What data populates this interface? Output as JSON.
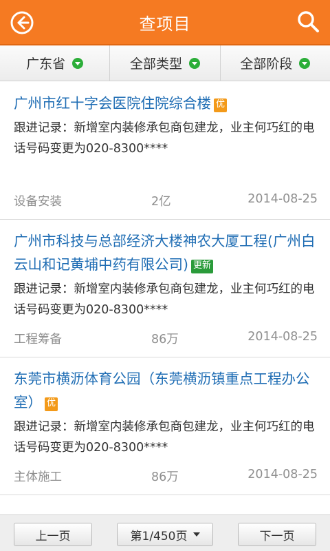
{
  "header": {
    "title": "查项目",
    "back_icon": "back-arrow-circle-icon",
    "search_icon": "magnifier-icon",
    "color": "#f57a22"
  },
  "filters": [
    {
      "label": "广东省"
    },
    {
      "label": "全部类型"
    },
    {
      "label": "全部阶段"
    }
  ],
  "projects": [
    {
      "name": "广州市红十字会医院住院综合楼",
      "badge": "优",
      "record": "跟进记录：新增室内装修承包商包建龙，业主何巧红的电话号码变更为020-8300****",
      "stage": "设备安装",
      "amount": "2亿",
      "date": "2014-08-25"
    },
    {
      "name": "广州市科技与总部经济大楼神农大厦工程(广州白云山和记黄埔中药有限公司)",
      "badge": "更新",
      "record": "跟进记录：新增室内装修承包商包建龙，业主何巧红的电话号码变更为020-8300****",
      "stage": "工程筹备",
      "amount": "86万",
      "date": "2014-08-25"
    },
    {
      "name": "东莞市横沥体育公园（东莞横沥镇重点工程办公室）",
      "badge": "优",
      "record": "跟进记录：新增室内装修承包商包建龙，业主何巧红的电话号码变更为020-8300****",
      "stage": "主体施工",
      "amount": "86万",
      "date": "2014-08-25"
    }
  ],
  "pager": {
    "prev": "上一页",
    "page": "第1/450页",
    "next": "下一页"
  }
}
